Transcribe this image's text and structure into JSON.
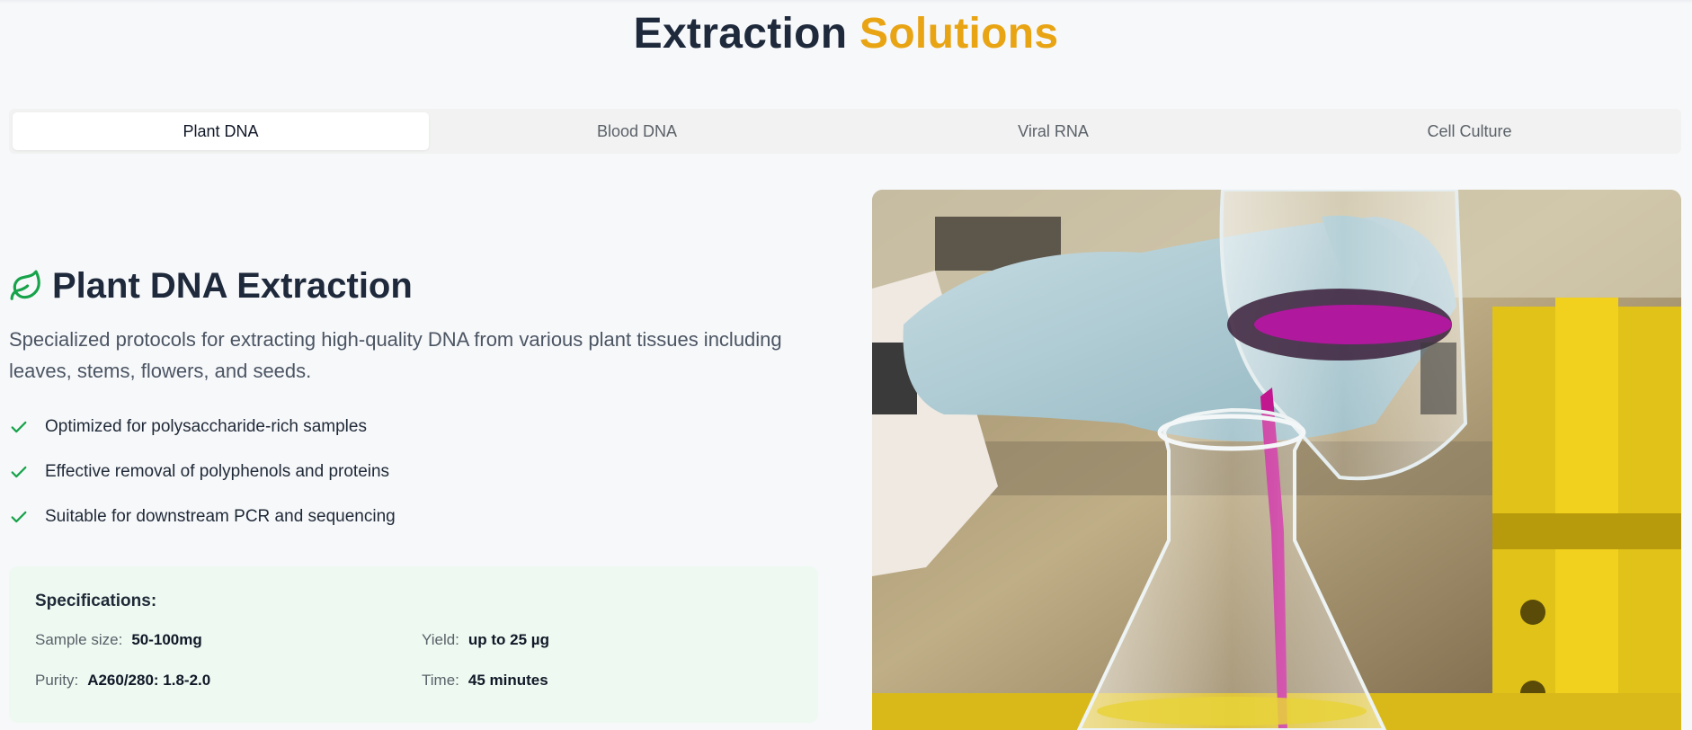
{
  "header": {
    "title_main": "Extraction",
    "title_accent": "Solutions",
    "accent_color": "#e8a413"
  },
  "tabs": [
    {
      "label": "Plant DNA",
      "active": true
    },
    {
      "label": "Blood DNA",
      "active": false
    },
    {
      "label": "Viral RNA",
      "active": false
    },
    {
      "label": "Cell Culture",
      "active": false
    }
  ],
  "content": {
    "icon": "leaf-icon",
    "heading": "Plant DNA Extraction",
    "description": "Specialized protocols for extracting high-quality DNA from various plant tissues including leaves, stems, flowers, and seeds.",
    "features": [
      "Optimized for polysaccharide-rich samples",
      "Effective removal of polyphenols and proteins",
      "Suitable for downstream PCR and sequencing"
    ],
    "feature_icon": "check-icon",
    "check_color": "#16a34a"
  },
  "specs": {
    "title": "Specifications:",
    "items": [
      {
        "label": "Sample size:",
        "value": "50-100mg"
      },
      {
        "label": "Yield:",
        "value": "up to 25 µg"
      },
      {
        "label": "Purity:",
        "value": "A260/280: 1.8-2.0"
      },
      {
        "label": "Time:",
        "value": "45 minutes"
      }
    ]
  },
  "image": {
    "subject": "lab-photo-pouring-purple-liquid-into-flask"
  }
}
